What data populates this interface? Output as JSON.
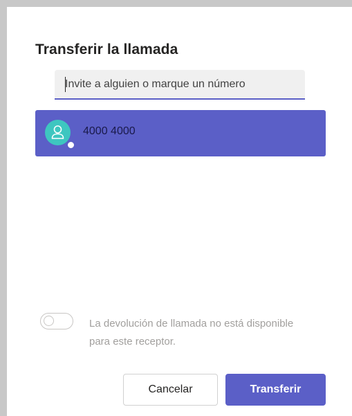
{
  "dialog": {
    "title": "Transferir la llamada"
  },
  "search": {
    "placeholder": "Invite a alguien o marque un número",
    "value": ""
  },
  "results": [
    {
      "label": "4000 4000",
      "avatar_icon": "person-icon",
      "presence_icon": "presence-dot-icon"
    }
  ],
  "callback_toggle": {
    "state": "off",
    "label": "La devolución de llamada no está disponible para este receptor."
  },
  "buttons": {
    "cancel": "Cancelar",
    "transfer": "Transferir"
  },
  "colors": {
    "accent": "#5b5fc7",
    "avatar": "#3ec6c0",
    "disabled_text": "#a19f9d"
  }
}
